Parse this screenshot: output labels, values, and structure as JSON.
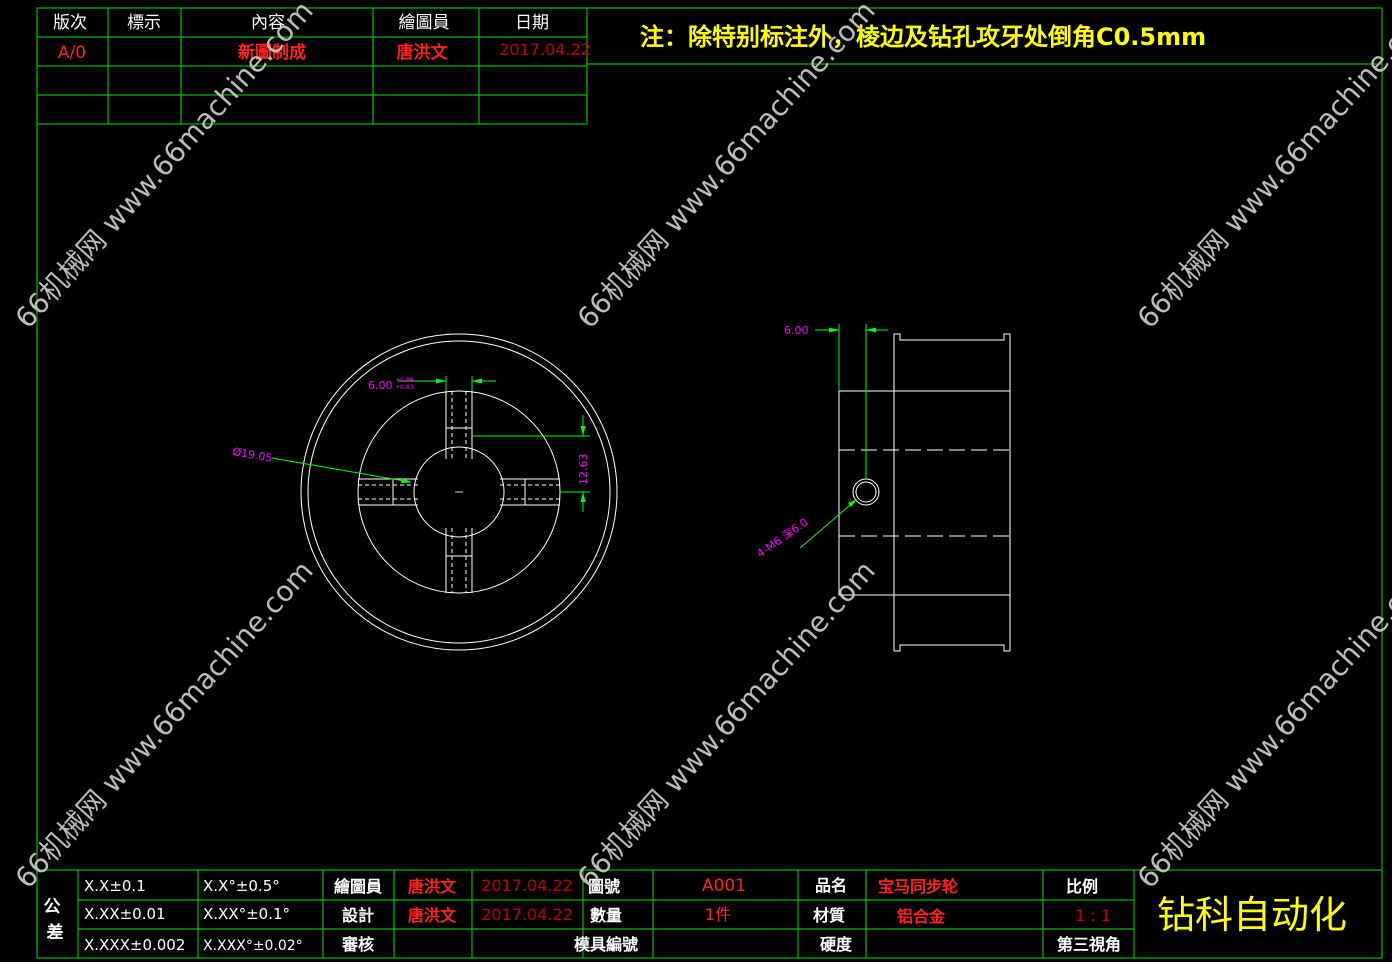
{
  "colors": {
    "frame": "#00e000",
    "geometry": "#ffffff",
    "dimension": "#ff00ff",
    "leader": "#00ff00",
    "header_text": "#ffffff",
    "red_text": "#ff2020",
    "date_text": "#c00000",
    "note_text": "#ffff00",
    "company_text": "#ffff00",
    "watermark": "#cfcfcf"
  },
  "revision_table": {
    "headers": [
      "版次",
      "標示",
      "內容",
      "繪圖員",
      "日期"
    ],
    "rows": [
      [
        "A/0",
        "",
        "新圖制成",
        "唐洪文",
        "2017.04.22"
      ],
      [
        "",
        "",
        "",
        "",
        ""
      ],
      [
        "",
        "",
        "",
        "",
        ""
      ]
    ]
  },
  "note": "注：除特别标注外，棱边及钻孔攻牙处倒角C0.5mm",
  "dimensions": {
    "slot_width": "6.00",
    "slot_tol_upper": "+0.08",
    "slot_tol_lower": "+0.03",
    "bore_dia": "Ø19.05",
    "slot_depth": "12.63",
    "side_offset": "6.00",
    "thread": "4-M6 深6.0"
  },
  "title_block": {
    "tolerance_label": "公差",
    "tol_linear": [
      "X.X±0.1",
      "X.XX±0.01",
      "X.XXX±0.002"
    ],
    "tol_angular": [
      "X.X°±0.5°",
      "X.XX°±0.1°",
      "X.XXX°±0.02°"
    ],
    "drawer_label": "繪圖員",
    "drawer_name": "唐洪文",
    "drawer_date": "2017.04.22",
    "designer_label": "設計",
    "designer_name": "唐洪文",
    "designer_date": "2017.04.22",
    "review_label": "審核",
    "drawing_no_label": "圖號",
    "drawing_no": "A001",
    "qty_label": "數量",
    "qty": "1件",
    "mold_no_label": "模具編號",
    "part_name_label": "品名",
    "part_name": "宝马同步轮",
    "material_label": "材質",
    "material": "铝合金",
    "hardness_label": "硬度",
    "scale_label": "比例",
    "scale": "1 : 1",
    "projection": "第三視角",
    "company": "钻科自动化"
  },
  "watermark": "66机械网 www.66machine.com"
}
